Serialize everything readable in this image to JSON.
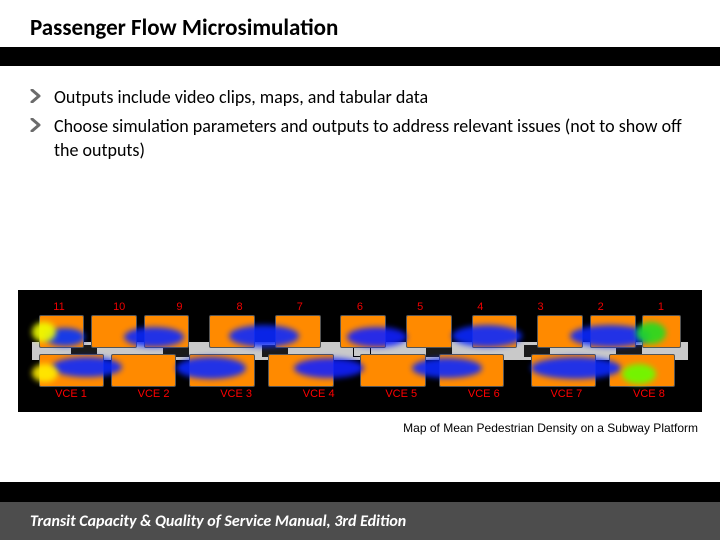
{
  "title": "Passenger Flow Microsimulation",
  "bullets": [
    "Outputs include video clips, maps, and tabular data",
    "Choose simulation parameters and outputs to address relevant issues (not to show off the outputs)"
  ],
  "figure": {
    "top_labels": [
      "11",
      "10",
      "9",
      "8",
      "7",
      "6",
      "5",
      "4",
      "3",
      "2",
      "1"
    ],
    "bottom_labels": [
      "VCE 1",
      "VCE 2",
      "VCE 3",
      "VCE 4",
      "VCE 5",
      "VCE 6",
      "VCE 7",
      "VCE 8"
    ],
    "caption": "Map of Mean Pedestrian Density on a Subway Platform"
  },
  "footer": "Transit Capacity & Quality of Service Manual, 3rd Edition"
}
